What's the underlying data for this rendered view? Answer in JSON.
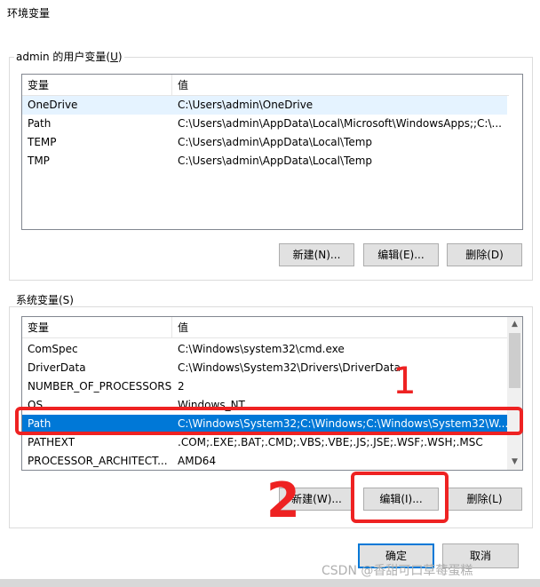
{
  "window": {
    "title": "环境变量"
  },
  "user_vars": {
    "group_label": "admin 的用户变量(",
    "group_label_key": "U",
    "group_label_end": ")",
    "columns": [
      "变量",
      "值"
    ],
    "rows": [
      {
        "name": "OneDrive",
        "value": "C:\\Users\\admin\\OneDrive"
      },
      {
        "name": "Path",
        "value": "C:\\Users\\admin\\AppData\\Local\\Microsoft\\WindowsApps;;C:\\..."
      },
      {
        "name": "TEMP",
        "value": "C:\\Users\\admin\\AppData\\Local\\Temp"
      },
      {
        "name": "TMP",
        "value": "C:\\Users\\admin\\AppData\\Local\\Temp"
      }
    ],
    "new_label": "新建(N)...",
    "edit_label": "编辑(E)...",
    "delete_label": "删除(D)"
  },
  "system_vars": {
    "group_label": "系统变量(S)",
    "columns": [
      "变量",
      "值"
    ],
    "rows": [
      {
        "name": "ComSpec",
        "value": "C:\\Windows\\system32\\cmd.exe"
      },
      {
        "name": "DriverData",
        "value": "C:\\Windows\\System32\\Drivers\\DriverData"
      },
      {
        "name": "NUMBER_OF_PROCESSORS",
        "value": "2"
      },
      {
        "name": "OS",
        "value": "Windows_NT"
      },
      {
        "name": "Path",
        "value": "C:\\Windows\\System32;C:\\Windows;C:\\Windows\\System32\\W..."
      },
      {
        "name": "PATHEXT",
        "value": ".COM;.EXE;.BAT;.CMD;.VBS;.VBE;.JS;.JSE;.WSF;.WSH;.MSC"
      },
      {
        "name": "PROCESSOR_ARCHITECT...",
        "value": "AMD64"
      }
    ],
    "selected_index": 4,
    "new_label": "新建(W)...",
    "edit_label": "编辑(I)...",
    "delete_label": "删除(L)"
  },
  "dialog": {
    "ok_label": "确定",
    "cancel_label": "取消"
  },
  "annotations": {
    "num1": "1",
    "num2": "2",
    "color": "#ee2222"
  },
  "watermark": "CSDN @香甜可口草莓蛋糕",
  "colors": {
    "selected_row": "#0078d7",
    "hover_row": "#e5f3ff",
    "default_button_border": "#0078d7"
  }
}
